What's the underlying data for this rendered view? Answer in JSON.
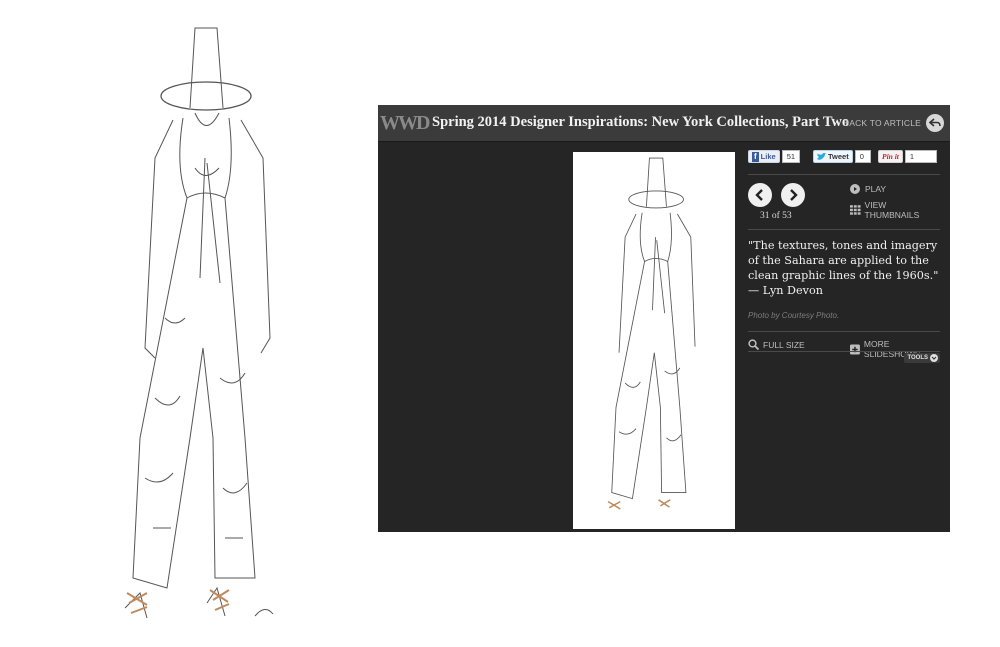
{
  "header": {
    "logo": "WWD",
    "title": "Spring 2014 Designer Inspirations: New York Collections, Part Two",
    "back_label": "BACK TO ARTICLE"
  },
  "social": {
    "facebook_label": "Like",
    "facebook_count": "51",
    "twitter_label": "Tweet",
    "twitter_count": "0",
    "pinterest_label": "Pin it",
    "pinterest_count": "1"
  },
  "navigation": {
    "counter": "31 of 53",
    "play_label": "PLAY",
    "thumbnails_label": "VIEW THUMBNAILS"
  },
  "caption": {
    "quote": "\"The textures, tones and imagery of the Sahara are applied to the clean graphic lines of the 1960s.\" — Lyn Devon",
    "credit": "Photo by Courtesy Photo."
  },
  "tools": {
    "full_size_label": "FULL SIZE",
    "more_slideshows_label": "MORE SLIDESHOWS",
    "tools_label": "TOOLS"
  },
  "icons": [
    "back-icon",
    "facebook-icon",
    "twitter-icon",
    "pinterest-icon",
    "prev-arrow-icon",
    "next-arrow-icon",
    "play-icon",
    "grid-icon",
    "magnifier-icon",
    "plus-icon",
    "chevron-down-icon"
  ],
  "colors": {
    "panel_bg": "#252525",
    "topbar_bg": "#3b3b3b"
  }
}
